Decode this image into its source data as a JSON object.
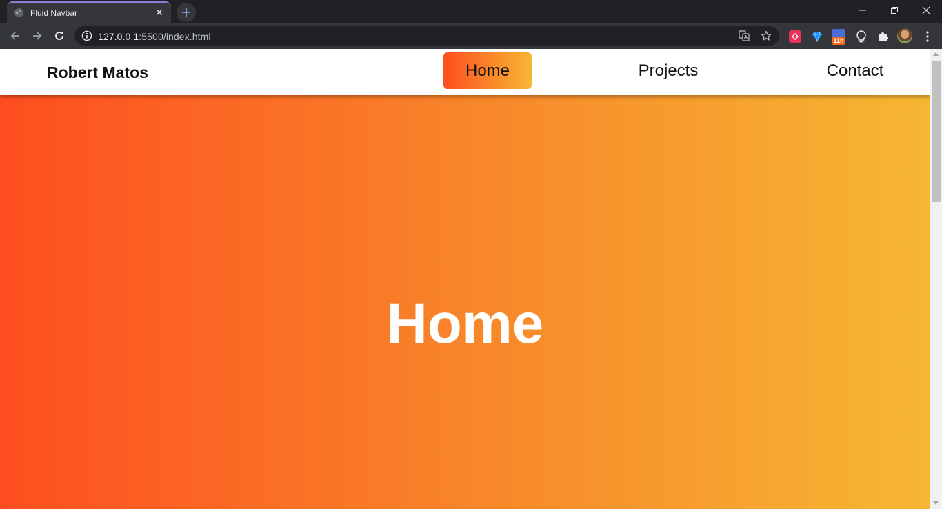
{
  "browser": {
    "tab_title": "Fluid Navbar",
    "tab_close": "✕",
    "url_host": "127.0.0.1",
    "url_rest": ":5500/index.html",
    "extension_badge": "11h"
  },
  "page": {
    "brand": "Robert Matos",
    "nav": [
      {
        "label": "Home",
        "active": true
      },
      {
        "label": "Projects",
        "active": false
      },
      {
        "label": "Contact",
        "active": false
      }
    ],
    "hero_title": "Home"
  },
  "colors": {
    "gradient_start": "#fe4e1f",
    "gradient_end": "#f6b733",
    "navbar_bg": "#ffffff",
    "chrome_dark": "#202124",
    "chrome_toolbar": "#35363a"
  }
}
